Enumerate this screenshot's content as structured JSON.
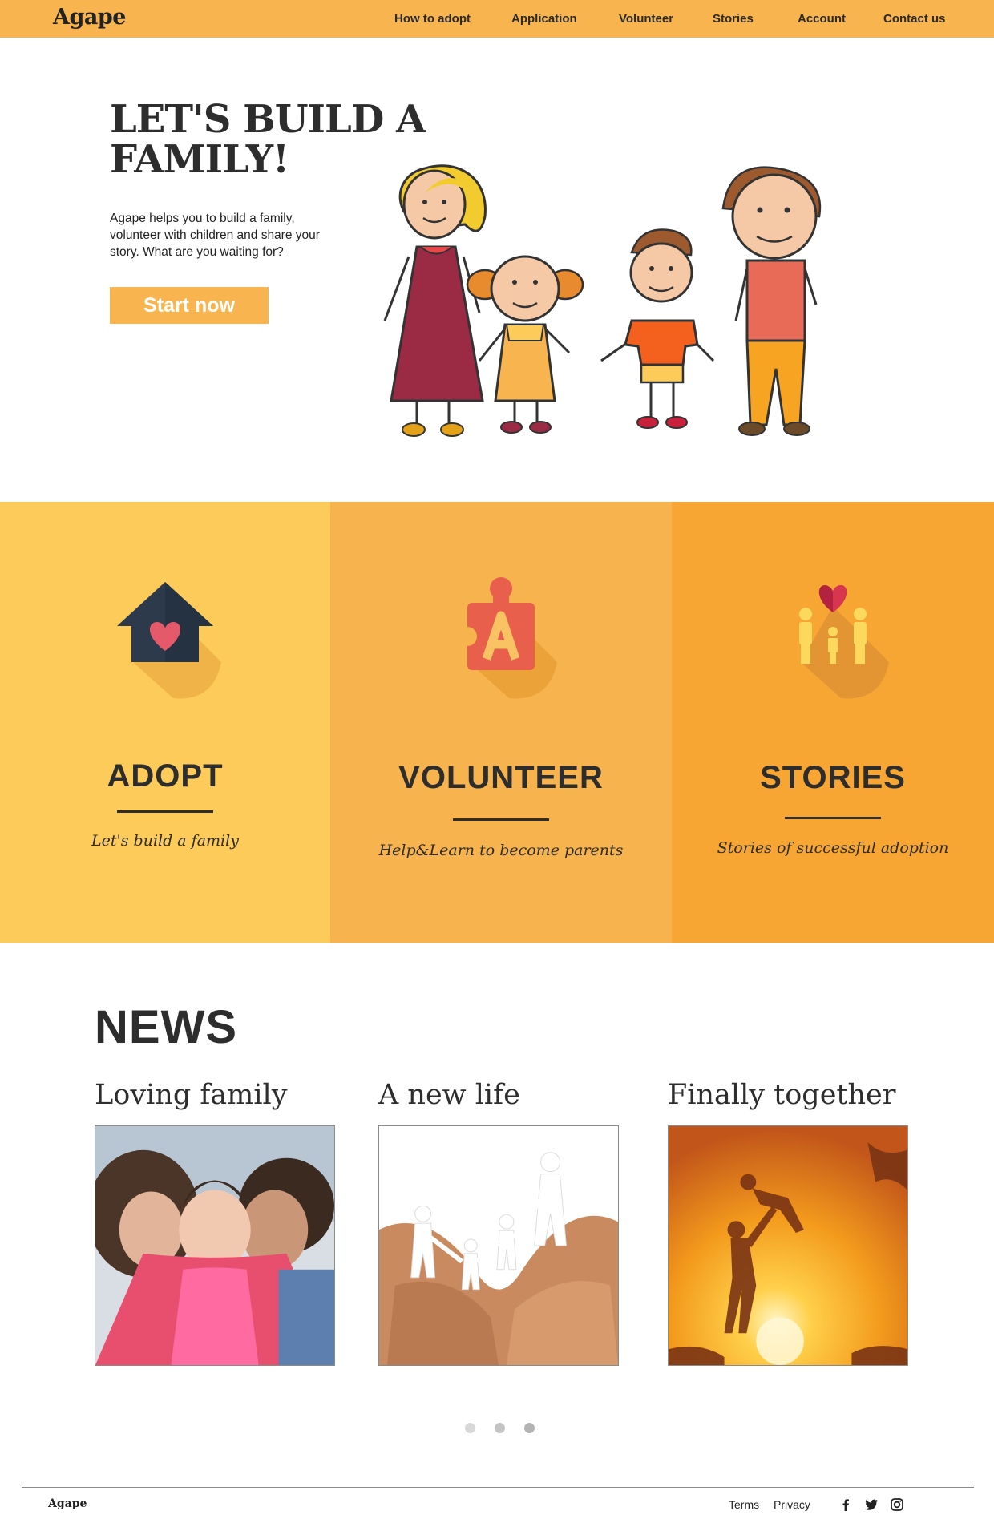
{
  "brand": "Agape",
  "nav": {
    "links": [
      "How to adopt",
      "Application",
      "Volunteer",
      "Stories",
      "Account",
      "Contact us"
    ]
  },
  "hero": {
    "title": "LET'S BUILD A FAMILY!",
    "text": "Agape helps you to build a family, volunteer with children and share your story. What are you waiting for?",
    "cta": "Start now"
  },
  "panels": [
    {
      "title": "ADOPT",
      "subtitle": "Let's build a family",
      "icon": "house-heart-icon",
      "color": "#FCCB5A"
    },
    {
      "title": "VOLUNTEER",
      "subtitle": "Help&Learn to become parents",
      "icon": "puzzle-piece-icon",
      "color": "#F7B34E"
    },
    {
      "title": "STORIES",
      "subtitle": "Stories of successful adoption",
      "icon": "family-heart-icon",
      "color": "#F8A633"
    }
  ],
  "news": {
    "heading": "NEWS",
    "items": [
      {
        "title": "Loving family"
      },
      {
        "title": "A new life"
      },
      {
        "title": "Finally together"
      }
    ],
    "dots": 3
  },
  "footer": {
    "brand": "Agape",
    "links": [
      "Terms",
      "Privacy"
    ],
    "social": [
      "facebook-icon",
      "twitter-icon",
      "instagram-icon"
    ]
  },
  "colors": {
    "accent": "#F8B54F",
    "dark": "#2d2d2d"
  }
}
